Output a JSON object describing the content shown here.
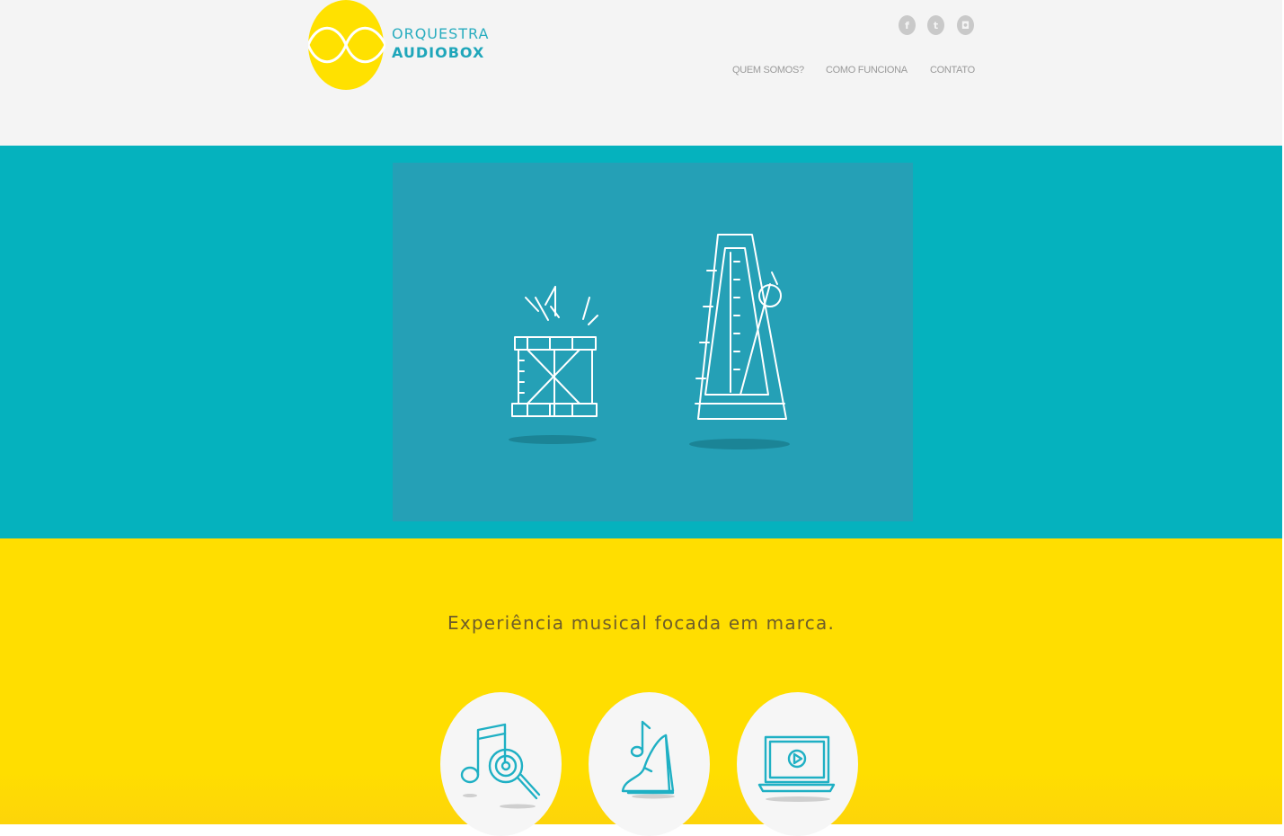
{
  "brand": {
    "line1": "ORQUESTRA",
    "line2": "AUDIOBOX",
    "logo_color": "#ffe100",
    "text_color": "#29adbf"
  },
  "social": [
    {
      "icon": "facebook-icon",
      "glyph": "f"
    },
    {
      "icon": "twitter-icon",
      "glyph": "t"
    },
    {
      "icon": "instagram-icon",
      "glyph": "◘"
    }
  ],
  "nav": {
    "items": [
      {
        "label": "QUEM SOMOS?"
      },
      {
        "label": "COMO FUNCIONA"
      },
      {
        "label": "CONTATO"
      }
    ]
  },
  "hero": {
    "illustrations": [
      "drum-illustration",
      "metronome-illustration"
    ],
    "bg_color": "#05b2be",
    "panel_color": "#25a0b6"
  },
  "features": {
    "tagline": "Experiência musical focada em marca.",
    "bg_color": "#ffde00",
    "items": [
      {
        "icon": "music-search-icon"
      },
      {
        "icon": "music-heel-icon"
      },
      {
        "icon": "laptop-video-icon"
      }
    ]
  }
}
